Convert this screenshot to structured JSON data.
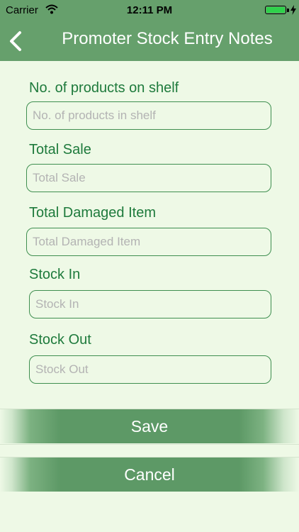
{
  "status_bar": {
    "carrier": "Carrier",
    "time": "12:11 PM",
    "icons": [
      "wifi-icon",
      "battery-icon",
      "charging-bolt-icon"
    ]
  },
  "nav": {
    "title": "Promoter Stock Entry Notes",
    "back_icon": "chevron-left-icon"
  },
  "form": {
    "fields": [
      {
        "label": "No. of products on shelf",
        "placeholder": "No. of products in shelf",
        "value": ""
      },
      {
        "label": "Total Sale",
        "placeholder": "Total Sale",
        "value": ""
      },
      {
        "label": "Total Damaged Item",
        "placeholder": "Total Damaged Item",
        "value": ""
      },
      {
        "label": "Stock In",
        "placeholder": "Stock In",
        "value": ""
      },
      {
        "label": "Stock Out",
        "placeholder": "Stock Out",
        "value": ""
      }
    ]
  },
  "actions": {
    "save_label": "Save",
    "cancel_label": "Cancel"
  },
  "colors": {
    "header": "#66a06c",
    "label": "#1e7a3c",
    "border": "#3f8f50",
    "background": "#eef9e6",
    "button": "#5d9966"
  }
}
